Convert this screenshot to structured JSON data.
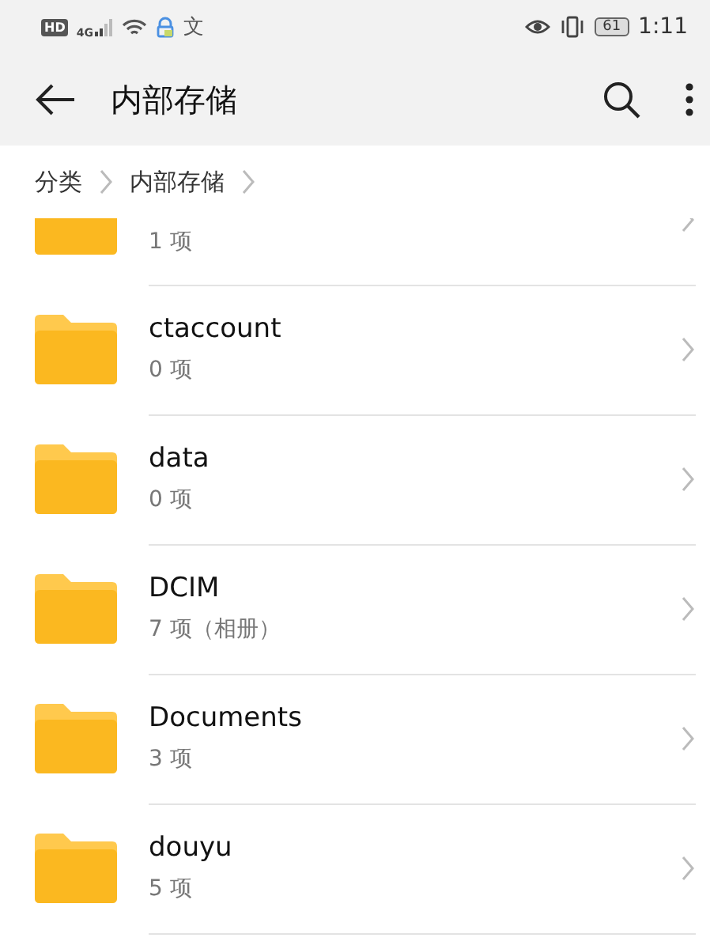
{
  "status_bar": {
    "hd": "HD",
    "network": "4G",
    "app_glyph": "文",
    "battery": "61",
    "time": "1:11"
  },
  "toolbar": {
    "title": "内部存储"
  },
  "breadcrumb": [
    {
      "label": "分类"
    },
    {
      "label": "内部存储"
    }
  ],
  "files": [
    {
      "count": "1 项"
    },
    {
      "name": "ctaccount",
      "count": "0 项"
    },
    {
      "name": "data",
      "count": "0 项"
    },
    {
      "name": "DCIM",
      "count": "7 项（相册）"
    },
    {
      "name": "Documents",
      "count": "3 项"
    },
    {
      "name": "douyu",
      "count": "5 项"
    }
  ]
}
